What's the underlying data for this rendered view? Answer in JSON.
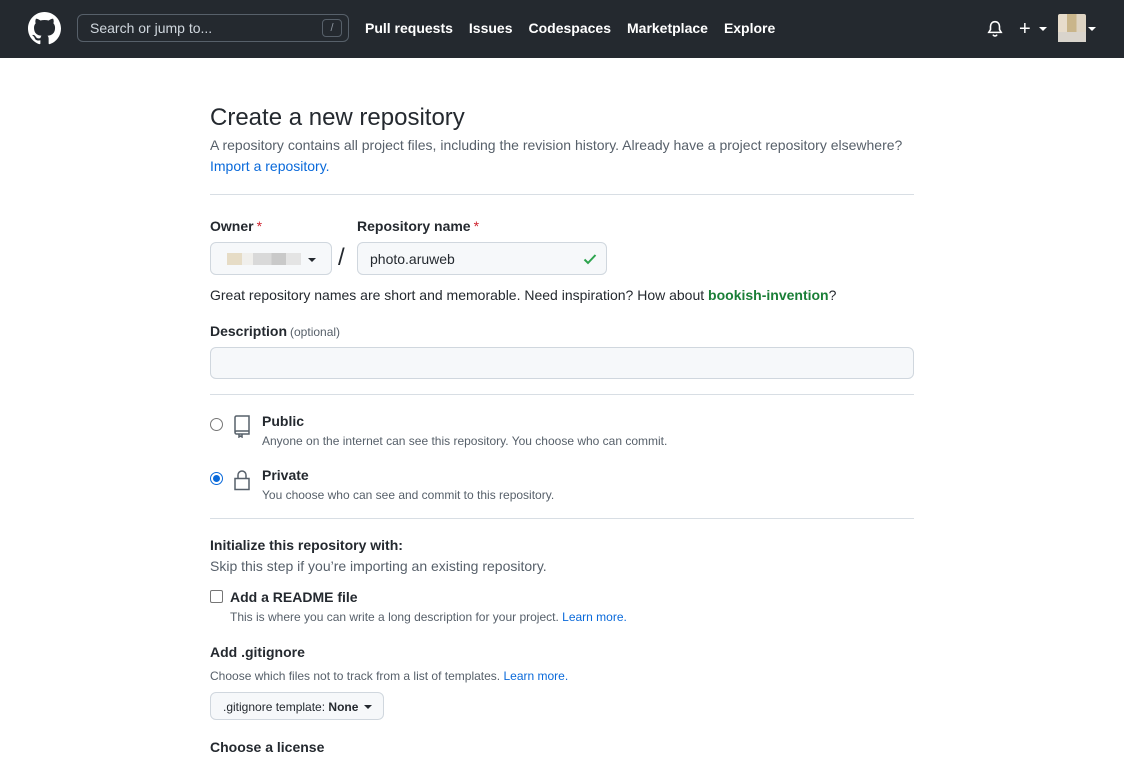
{
  "header": {
    "search_placeholder": "Search or jump to...",
    "search_shortcut": "/",
    "nav": [
      "Pull requests",
      "Issues",
      "Codespaces",
      "Marketplace",
      "Explore"
    ],
    "plus_label": "+"
  },
  "page": {
    "title": "Create a new repository",
    "subtitle": "A repository contains all project files, including the revision history. Already have a project repository elsewhere?",
    "import_link": "Import a repository."
  },
  "form": {
    "owner_label": "Owner",
    "repo_label": "Repository name",
    "required_mark": "*",
    "separator": "/",
    "repo_value": "photo.aruweb",
    "hint_text": "Great repository names are short and memorable. Need inspiration? How about ",
    "hint_suggestion": "bookish-invention",
    "hint_end": "?",
    "description_label": "Description",
    "description_optional": "(optional)",
    "description_value": ""
  },
  "visibility": {
    "public": {
      "title": "Public",
      "desc": "Anyone on the internet can see this repository. You choose who can commit.",
      "checked": false
    },
    "private": {
      "title": "Private",
      "desc": "You choose who can see and commit to this repository.",
      "checked": true
    }
  },
  "init": {
    "title": "Initialize this repository with:",
    "desc": "Skip this step if you’re importing an existing repository.",
    "readme_title": "Add a README file",
    "readme_desc": "This is where you can write a long description for your project. ",
    "readme_link": "Learn more.",
    "gitignore_title": "Add .gitignore",
    "gitignore_desc": "Choose which files not to track from a list of templates. ",
    "gitignore_link": "Learn more.",
    "gitignore_btn_prefix": ".gitignore template: ",
    "gitignore_btn_value": "None",
    "license_title": "Choose a license"
  },
  "colors": {
    "header_bg": "#24292f",
    "link": "#0969da",
    "success": "#1a7f37",
    "required": "#cf222e"
  }
}
